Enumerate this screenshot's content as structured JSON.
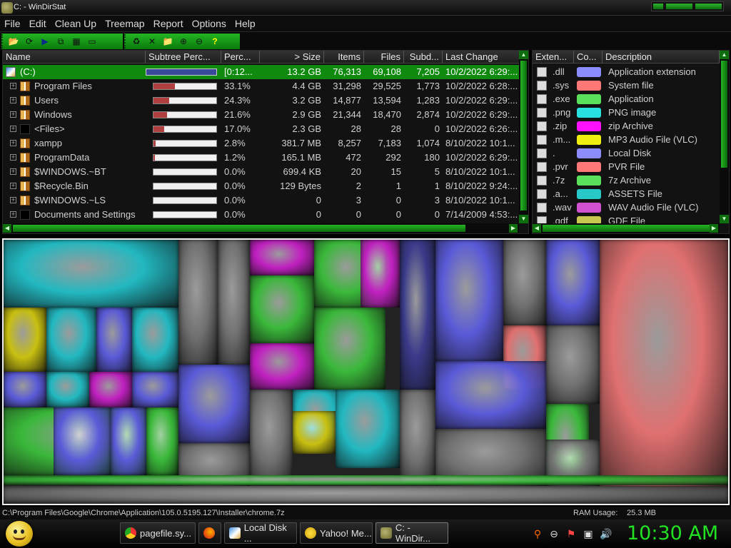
{
  "window": {
    "title": "C: - WinDirStat"
  },
  "menu": [
    "File",
    "Edit",
    "Clean Up",
    "Treemap",
    "Report",
    "Options",
    "Help"
  ],
  "toolbar": {
    "group1": [
      "open-icon",
      "refresh-icon",
      "run-icon",
      "copy-icon",
      "explorer-icon",
      "cmd-icon"
    ],
    "group2": [
      "recycle-delete-icon",
      "delete-icon",
      "folder-icon",
      "zoom-in-icon",
      "zoom-out-icon",
      "help-icon"
    ]
  },
  "dir_columns": [
    "Name",
    "Subtree Perc...",
    "Perc...",
    "> Size",
    "Items",
    "Files",
    "Subd...",
    "Last Change"
  ],
  "dir_rows": [
    {
      "name": "(C:)",
      "perc": "[0:12...",
      "size": "13.2 GB",
      "items": "76,313",
      "files": "69,108",
      "subdirs": "7,205",
      "changed": "10/2/2022  6:29:...",
      "fill": 1.0,
      "icon": "drive",
      "selected": true
    },
    {
      "name": "Program Files",
      "perc": "33.1%",
      "size": "4.4 GB",
      "items": "31,298",
      "files": "29,525",
      "subdirs": "1,773",
      "changed": "10/2/2022  6:28:...",
      "fill": 0.331,
      "icon": "folder"
    },
    {
      "name": "Users",
      "perc": "24.3%",
      "size": "3.2 GB",
      "items": "14,877",
      "files": "13,594",
      "subdirs": "1,283",
      "changed": "10/2/2022  6:29:...",
      "fill": 0.243,
      "icon": "folder"
    },
    {
      "name": "Windows",
      "perc": "21.6%",
      "size": "2.9 GB",
      "items": "21,344",
      "files": "18,470",
      "subdirs": "2,874",
      "changed": "10/2/2022  6:29:...",
      "fill": 0.216,
      "icon": "folder"
    },
    {
      "name": "<Files>",
      "perc": "17.0%",
      "size": "2.3 GB",
      "items": "28",
      "files": "28",
      "subdirs": "0",
      "changed": "10/2/2022  6:26:...",
      "fill": 0.17,
      "icon": "black"
    },
    {
      "name": "xampp",
      "perc": "2.8%",
      "size": "381.7 MB",
      "items": "8,257",
      "files": "7,183",
      "subdirs": "1,074",
      "changed": "8/10/2022  10:1...",
      "fill": 0.028,
      "icon": "folder"
    },
    {
      "name": "ProgramData",
      "perc": "1.2%",
      "size": "165.1 MB",
      "items": "472",
      "files": "292",
      "subdirs": "180",
      "changed": "10/2/2022  6:29:...",
      "fill": 0.012,
      "icon": "folder"
    },
    {
      "name": "$WINDOWS.~BT",
      "perc": "0.0%",
      "size": "699.4 KB",
      "items": "20",
      "files": "15",
      "subdirs": "5",
      "changed": "8/10/2022  10:1...",
      "fill": 0.0,
      "icon": "folder"
    },
    {
      "name": "$Recycle.Bin",
      "perc": "0.0%",
      "size": "129 Bytes",
      "items": "2",
      "files": "1",
      "subdirs": "1",
      "changed": "8/10/2022  9:24:...",
      "fill": 0.0,
      "icon": "folder"
    },
    {
      "name": "$WINDOWS.~LS",
      "perc": "0.0%",
      "size": "0",
      "items": "3",
      "files": "0",
      "subdirs": "3",
      "changed": "8/10/2022  10:1...",
      "fill": 0.0,
      "icon": "folder"
    },
    {
      "name": "Documents and Settings",
      "perc": "0.0%",
      "size": "0",
      "items": "0",
      "files": "0",
      "subdirs": "0",
      "changed": "7/14/2009  4:53:...",
      "fill": 0.0,
      "icon": "black"
    }
  ],
  "ext_columns": [
    "Exten...",
    "Co...",
    "Description"
  ],
  "ext_rows": [
    {
      "ext": ".dll",
      "color": "#8c8cff",
      "desc": "Application extension"
    },
    {
      "ext": ".sys",
      "color": "#ff7878",
      "desc": "System file"
    },
    {
      "ext": ".exe",
      "color": "#5ae05a",
      "desc": "Application"
    },
    {
      "ext": ".png",
      "color": "#28e0e0",
      "desc": "PNG image"
    },
    {
      "ext": ".zip",
      "color": "#ff10ff",
      "desc": "zip Archive"
    },
    {
      "ext": ".m...",
      "color": "#f0f010",
      "desc": "MP3 Audio File (VLC)"
    },
    {
      "ext": ".",
      "color": "#8c8cff",
      "desc": "Local Disk"
    },
    {
      "ext": ".pvr",
      "color": "#ff7878",
      "desc": "PVR File"
    },
    {
      "ext": ".7z",
      "color": "#5ae05a",
      "desc": "7z Archive"
    },
    {
      "ext": ".a...",
      "color": "#28c8c8",
      "desc": "ASSETS File"
    },
    {
      "ext": ".wav",
      "color": "#d050d0",
      "desc": "WAV Audio File (VLC)"
    },
    {
      "ext": ".gdf",
      "color": "#c8c850",
      "desc": "GDF File"
    }
  ],
  "status": {
    "path": "C:\\Program Files\\Google\\Chrome\\Application\\105.0.5195.127\\Installer\\chrome.7z",
    "ram_label": "RAM Usage:",
    "ram_value": "25.3 MB"
  },
  "taskbar": {
    "tasks": [
      {
        "label": "pagefile.sy...",
        "icon": "chrome-icon"
      },
      {
        "label": "",
        "icon": "firefox-icon"
      },
      {
        "label": "Local Disk ...",
        "icon": "explorer-icon"
      },
      {
        "label": "Yahoo! Me...",
        "icon": "messenger-icon"
      },
      {
        "label": "C: - WinDir...",
        "icon": "windirstat-icon",
        "active": true
      }
    ],
    "clock": "10:30 AM"
  },
  "colors": {
    "accent_green": "#0f8a0f",
    "clock_green": "#22e022"
  }
}
